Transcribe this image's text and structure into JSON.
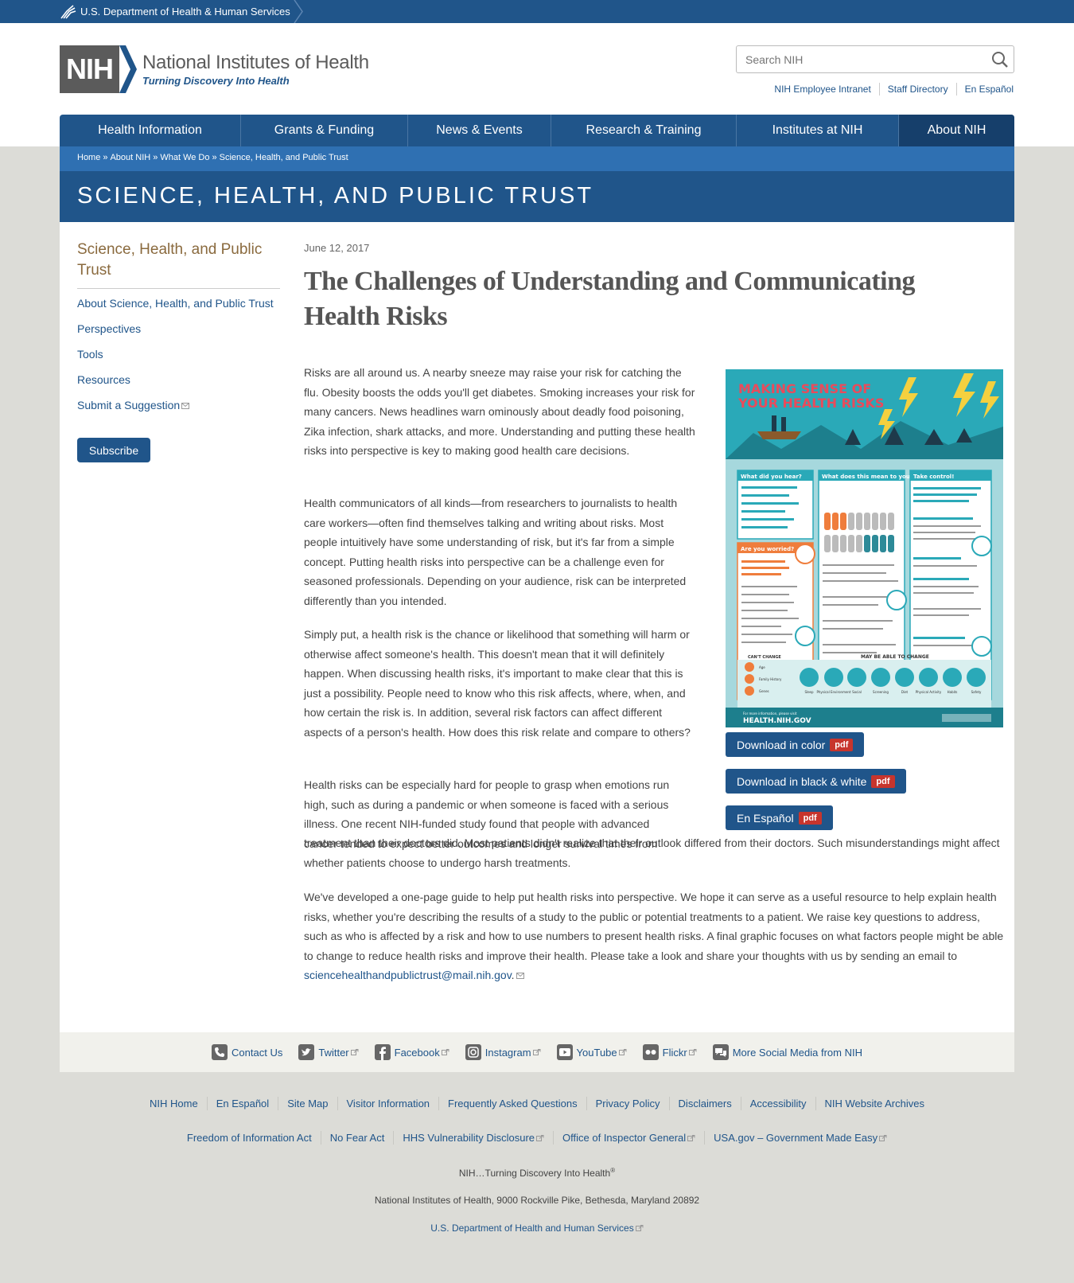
{
  "hhs": {
    "label": "U.S. Department of Health & Human Services"
  },
  "logo": {
    "abbr": "NIH",
    "name": "National Institutes of Health",
    "tagline": "Turning Discovery Into Health"
  },
  "search": {
    "placeholder": "Search NIH"
  },
  "utility_links": [
    "NIH Employee Intranet",
    "Staff Directory",
    "En Español"
  ],
  "nav": [
    "Health Information",
    "Grants & Funding",
    "News & Events",
    "Research & Training",
    "Institutes at NIH",
    "About NIH"
  ],
  "breadcrumb": [
    "Home",
    "About NIH",
    "What We Do",
    "Science, Health, and Public Trust"
  ],
  "breadcrumb_sep": "»",
  "section_title": "SCIENCE, HEALTH, AND PUBLIC TRUST",
  "sidebar": {
    "title": "Science, Health, and Public Trust",
    "links": [
      "About Science, Health, and Public Trust",
      "Perspectives",
      "Tools",
      "Resources",
      "Submit a Suggestion"
    ],
    "subscribe": "Subscribe"
  },
  "article": {
    "date": "June 12, 2017",
    "title": "The Challenges of Understanding and Communicating Health Risks",
    "p1": "Risks are all around us. A nearby sneeze may raise your risk for catching the flu. Obesity boosts the odds you'll get diabetes. Smoking increases your risk for many cancers. News headlines warn ominously about deadly food poisoning, Zika infection, shark attacks, and more. Understanding and putting these health risks into perspective is key to making good health care decisions.",
    "p2": "Health communicators of all kinds—from researchers to journalists to health care workers—often find themselves talking and writing about risks. Most people intuitively have some understanding of risk, but it's far from a simple concept. Putting health risks into perspective can be a challenge even for seasoned professionals. Depending on your audience, risk can be interpreted differently than you intended.",
    "p3": "Simply put, a health risk is the chance or likelihood that something will harm or otherwise affect someone's health. This doesn't mean that it will definitely happen. When discussing health risks, it's important to make clear that this is just a possibility. People need to know who this risk affects, where, when, and how certain the risk is. In addition, several risk factors can affect different aspects of a person's health. How does this risk relate and compare to others?",
    "p4a": "Health risks can be especially hard for people to grasp when emotions run high, such as during a pandemic or when someone is faced with a serious illness. One recent NIH-funded study found that people with advanced cancer tended to expect better outcomes and longer survival times from",
    "p4b": "treatment than their doctors did. Most patients didn't realize that their outlook differed from their doctors. Such misunderstandings might affect whether patients choose to undergo harsh treatments.",
    "p5": "We've developed a one-page guide to help put health risks into perspective. We hope it can serve as a useful resource to help explain health risks, whether you're describing the results of a study to the public or potential treatments to a patient. We raise key questions to address, such as who is affected by a risk and how to use numbers to present health risks. A final graphic focuses on what factors people might be able to change to reduce health risks and improve their health. Please take a look and share your thoughts with us by sending an email to",
    "email": "sciencehealthandpublictrust@mail.nih.gov",
    "period": "."
  },
  "infographic": {
    "title_line1": "MAKING SENSE OF",
    "title_line2": "YOUR HEALTH RISKS",
    "col1": "What did you hear?",
    "col2": "What does this mean to you?",
    "col3": "Take control!",
    "worried": "Are you worried?",
    "cant_change": "CAN'T CHANGE",
    "may_change": "MAY BE ABLE TO CHANGE",
    "cant_items": [
      "Age",
      "Family History",
      "Genes"
    ],
    "may_items": [
      "Sleep",
      "Physical Environment",
      "Social",
      "Screening",
      "Diet",
      "Physical Activity",
      "Habits",
      "Safety"
    ],
    "footer_small": "For more information, please visit",
    "footer_url": "HEALTH.NIH.GOV"
  },
  "downloads": [
    {
      "label": "Download in color",
      "badge": "pdf"
    },
    {
      "label": "Download in black & white",
      "badge": "pdf"
    },
    {
      "label": "En Español",
      "badge": "pdf"
    }
  ],
  "social": [
    "Contact Us",
    "Twitter",
    "Facebook",
    "Instagram",
    "YouTube",
    "Flickr",
    "More Social Media from NIH"
  ],
  "footer": {
    "row1": [
      "NIH Home",
      "En Español",
      "Site Map",
      "Visitor Information",
      "Frequently Asked Questions",
      "Privacy Policy",
      "Disclaimers",
      "Accessibility",
      "NIH Website Archives"
    ],
    "row2": [
      "Freedom of Information Act",
      "No Fear Act",
      "HHS Vulnerability Disclosure",
      "Office of Inspector General",
      "USA.gov – Government Made Easy"
    ],
    "tagline": "NIH…Turning Discovery Into Health",
    "reg": "®",
    "address": "National Institutes of Health, 9000 Rockville Pike, Bethesda, Maryland 20892",
    "hhs_link": "U.S. Department of Health and Human Services"
  },
  "colors": {
    "primary": "#20558a",
    "dark_nav": "#163f6b",
    "breadcrumb": "#2f70b2",
    "pdf_badge": "#c7352d",
    "sidebar_title": "#8a6a3e"
  }
}
